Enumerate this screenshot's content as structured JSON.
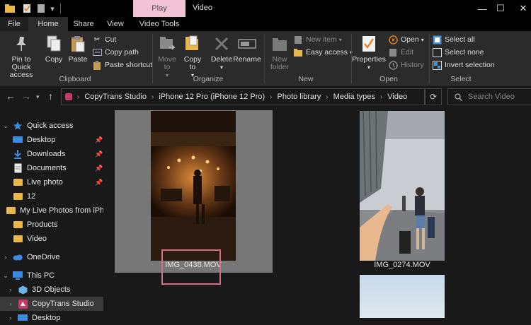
{
  "window": {
    "title": "Video",
    "context_tab": "Play",
    "controls": [
      "—",
      "☐",
      "✕"
    ]
  },
  "ribbon_tabs": [
    {
      "label": "File"
    },
    {
      "label": "Home"
    },
    {
      "label": "Share"
    },
    {
      "label": "View"
    },
    {
      "label": "Video Tools"
    }
  ],
  "ribbon": {
    "clipboard": {
      "group": "Clipboard",
      "pin": "Pin to Quick access",
      "copy": "Copy",
      "paste": "Paste",
      "cut": "Cut",
      "copy_path": "Copy path",
      "paste_shortcut": "Paste shortcut"
    },
    "organize": {
      "group": "Organize",
      "move_to": "Move to",
      "copy_to": "Copy to",
      "delete": "Delete",
      "rename": "Rename"
    },
    "new": {
      "group": "New",
      "new_folder": "New folder",
      "new_item": "New item",
      "easy_access": "Easy access"
    },
    "open": {
      "group": "Open",
      "properties": "Properties",
      "open": "Open",
      "edit": "Edit",
      "history": "History"
    },
    "select": {
      "group": "Select",
      "select_all": "Select all",
      "select_none": "Select none",
      "invert": "Invert selection"
    }
  },
  "address": {
    "crumbs": [
      "CopyTrans Studio",
      "iPhone 12 Pro (iPhone 12 Pro)",
      "Photo library",
      "Media types",
      "Video"
    ],
    "search_placeholder": "Search Video"
  },
  "nav": {
    "quick_access": "Quick access",
    "items": [
      {
        "label": "Desktop",
        "pinned": true
      },
      {
        "label": "Downloads",
        "pinned": true
      },
      {
        "label": "Documents",
        "pinned": true
      },
      {
        "label": "Live photo",
        "pinned": true
      },
      {
        "label": "12",
        "pinned": false
      },
      {
        "label": "My Live Photos from iPh",
        "pinned": false
      },
      {
        "label": "Products",
        "pinned": false
      },
      {
        "label": "Video",
        "pinned": false
      }
    ],
    "onedrive": "OneDrive",
    "this_pc": "This PC",
    "pc_items": [
      "3D Objects",
      "CopyTrans Studio",
      "Desktop"
    ]
  },
  "files": [
    {
      "name": "IMG_0438.MOV",
      "selected": true
    },
    {
      "name": "IMG_0274.MOV",
      "selected": false
    },
    {
      "name": "",
      "selected": false
    }
  ],
  "colors": {
    "accent_play": "#f2c3d4",
    "highlight_box": "#d66f86",
    "folder": "#e8b84a"
  }
}
